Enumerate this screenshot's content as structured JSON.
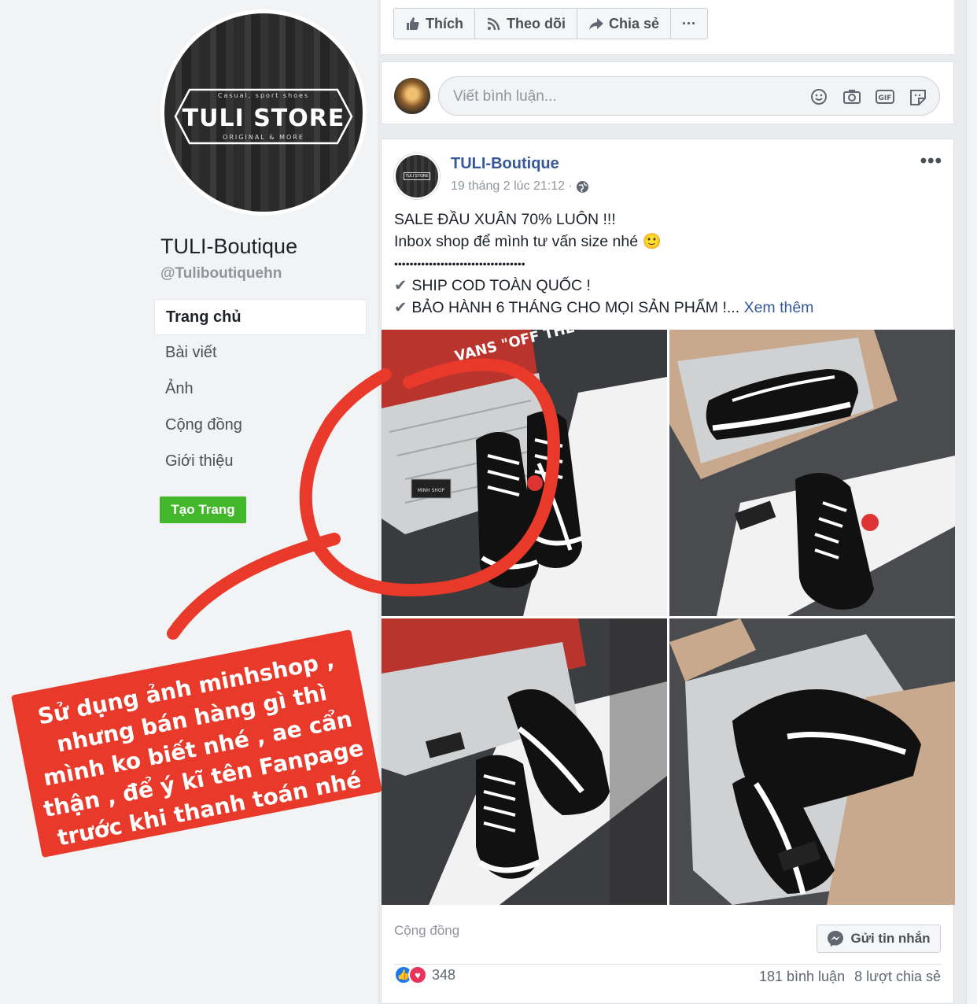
{
  "page": {
    "logo": {
      "tagline": "Casual, sport shoes",
      "name": "TULI STORE",
      "sub": "ORIGINAL & MORE"
    },
    "name": "TULI-Boutique",
    "handle": "@Tuliboutiquehn",
    "nav": [
      {
        "label": "Trang chủ",
        "active": true
      },
      {
        "label": "Bài viết"
      },
      {
        "label": "Ảnh"
      },
      {
        "label": "Cộng đồng"
      },
      {
        "label": "Giới thiệu"
      }
    ],
    "create_page_label": "Tạo Trang"
  },
  "actions": {
    "like": "Thích",
    "follow": "Theo dõi",
    "share": "Chia sẻ",
    "more": "···"
  },
  "comment_box": {
    "placeholder": "Viết bình luận..."
  },
  "post": {
    "author": "TULI-Boutique",
    "time": "19 tháng 2 lúc 21:12 ·",
    "more": "•••",
    "lines": {
      "l1": "SALE ĐẦU XUÂN 70% LUÔN !!!",
      "l2": "Inbox shop để mình tư vấn size nhé 🙂",
      "l3": "••••••••••••••••••••••••••••••••••",
      "l4": "SHIP COD TOÀN QUỐC !",
      "l5": "BẢO HÀNH 6 THÁNG CHO MỌI SẢN PHẨM !...",
      "see_more": "Xem thêm"
    },
    "footer_label": "Cộng đồng",
    "message_button": "Gửi tin nhắn",
    "reaction_count": "348",
    "comments": "181 bình luận",
    "shares": "8 lượt chia sẻ"
  },
  "annotation": {
    "text": [
      "Sử dụng ảnh minhshop ,",
      "nhưng bán hàng gì thì",
      "mình ko biết nhé , ae cẩn",
      "thận , để ý kĩ tên Fanpage",
      "trước khi thanh toán nhé"
    ],
    "color": "#e8392a"
  },
  "photo_text": {
    "box_brand": "VANS \"OFF THE WALL\"",
    "tag": "MINH SHOP"
  },
  "colors": {
    "link": "#365899",
    "green": "#42b72a",
    "like_blue": "#1877f2",
    "love_red": "#e8345c"
  }
}
